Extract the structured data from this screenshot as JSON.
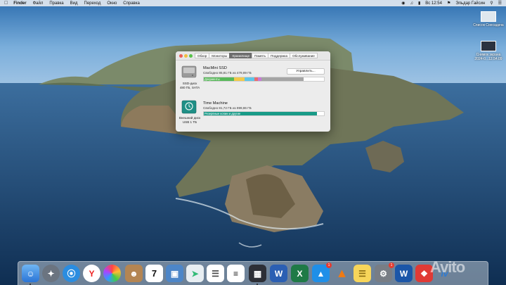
{
  "menubar": {
    "apple_icon": "apple-icon",
    "items": [
      "Finder",
      "Файл",
      "Правка",
      "Вид",
      "Переход",
      "Окно",
      "Справка"
    ],
    "clock": "Вс 12:54",
    "user": "Эльдар Гайсин"
  },
  "desktop": {
    "icons": [
      {
        "label": "Список Снесадача"
      },
      {
        "label": "Снимок экрана 2024-0...12.54.09"
      }
    ]
  },
  "window": {
    "tabs": [
      "Обзор",
      "Мониторы",
      "Хранилище",
      "Память",
      "Поддержка",
      "Обслуживание"
    ],
    "active_tab": "Хранилище",
    "disk1": {
      "name": "MacMini SSD",
      "free": "Свободно 85,81 ГБ из 479,89 ГБ",
      "caption_line1": "SSD-диск",
      "caption_line2": "480 ГБ, SATA",
      "manage_label": "Управлить...",
      "segments": [
        {
          "label": "Документы",
          "fraction": 0.25,
          "color": "#58b85a"
        },
        {
          "label": "",
          "fraction": 0.09,
          "color": "#f2c94a"
        },
        {
          "label": "",
          "fraction": 0.08,
          "color": "#5ec5e8"
        },
        {
          "label": "",
          "fraction": 0.03,
          "color": "#e96e6e"
        },
        {
          "label": "",
          "fraction": 0.03,
          "color": "#c77ad6"
        },
        {
          "label": "",
          "fraction": 0.35,
          "color": "#a5a5a5"
        }
      ]
    },
    "disk2": {
      "name": "Time Machine",
      "free": "Свободно 81,72 ГБ из 999,86 ГБ",
      "caption_line1": "Внешний диск",
      "caption_line2": "USB 1 ТБ",
      "segments": [
        {
          "label": "Резервные копии и другие",
          "fraction": 0.94,
          "color": "#199b88"
        }
      ]
    }
  },
  "dock": {
    "badge_appstore": "1",
    "badge_syspref": "1",
    "calendar_day": "7",
    "yandex": "Y",
    "word": "W",
    "excel": "X",
    "wps": "W",
    "iv": "iv",
    "watermark": "Avito"
  },
  "colors": {
    "accent": "#199b88",
    "tab_active": "#6d6d6d"
  }
}
